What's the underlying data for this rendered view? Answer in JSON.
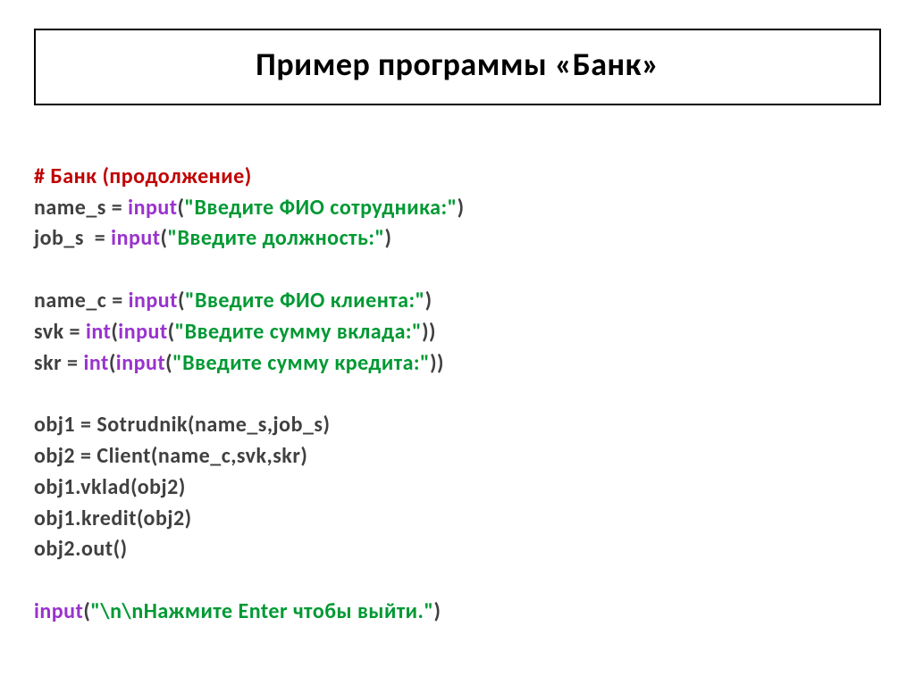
{
  "title": "Пример программы «Банк»",
  "comment": "# Банк (продолжение)",
  "l1a": "name_s = ",
  "l1f": "input",
  "l1b": "(",
  "l1s": "\"Введите ФИО сотрудника:\"",
  "l1c": ")",
  "l2a": "job_s  = ",
  "l2f": "input",
  "l2b": "(",
  "l2s": "\"Введите должность:\"",
  "l2c": ")",
  "l3a": "name_c = ",
  "l3f": "input",
  "l3b": "(",
  "l3s": "\"Введите ФИО клиента:\"",
  "l3c": ")",
  "l4a": "svk = ",
  "l4f1": "int",
  "l4b": "(",
  "l4f2": "input",
  "l4c": "(",
  "l4s": "\"Введите сумму вклада:\"",
  "l4d": "))",
  "l5a": "skr = ",
  "l5f1": "int",
  "l5b": "(",
  "l5f2": "input",
  "l5c": "(",
  "l5s": "\"Введите сумму кредита:\"",
  "l5d": "))",
  "l6": "obj1 = Sotrudnik(name_s,job_s)",
  "l7": "obj2 = Client(name_c,svk,skr)",
  "l8": "obj1.vklad(obj2)",
  "l9": "obj1.kredit(obj2)",
  "l10": "obj2.out()",
  "l11f": "input",
  "l11a": "(",
  "l11s": "\"\\n\\nНажмите Enter чтобы выйти.\"",
  "l11b": ")"
}
